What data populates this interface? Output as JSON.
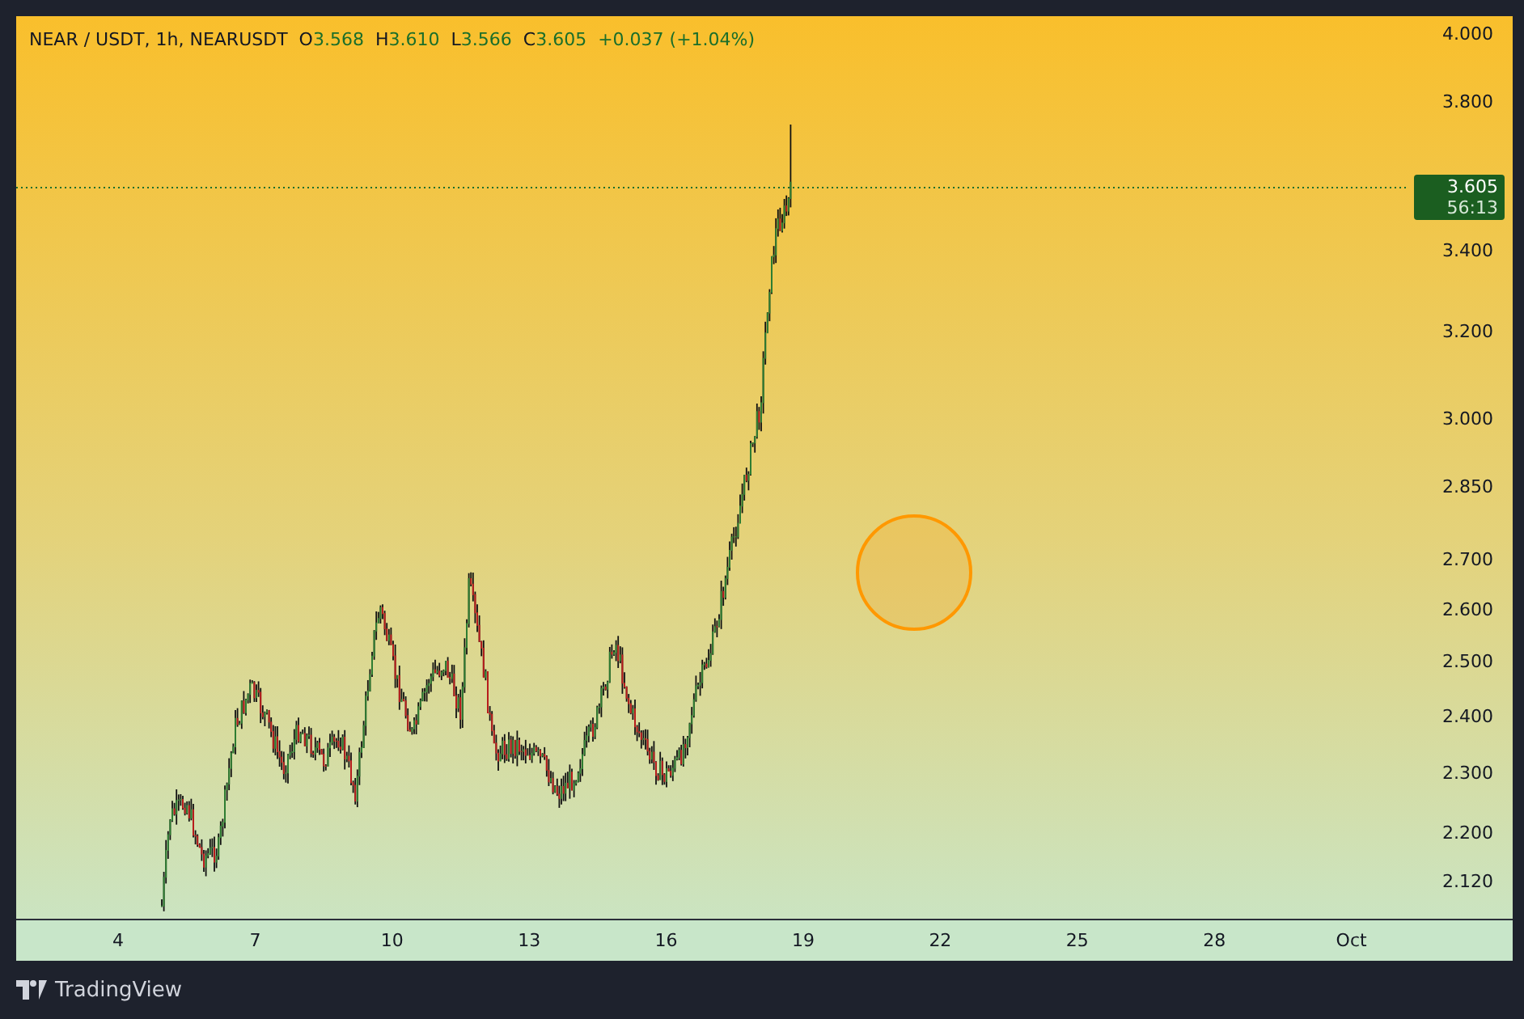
{
  "header": {
    "symbol": "NEAR / USDT, 1h, NEARUSDT",
    "ohlc": [
      {
        "label": "O",
        "value": "3.568"
      },
      {
        "label": "H",
        "value": "3.610"
      },
      {
        "label": "L",
        "value": "3.566"
      },
      {
        "label": "C",
        "value": "3.605"
      }
    ],
    "change": "+0.037 (+1.04%)"
  },
  "price_axis": {
    "ticks": [
      "4.000",
      "3.800",
      "3.400",
      "3.200",
      "3.000",
      "2.850",
      "2.700",
      "2.600",
      "2.500",
      "2.400",
      "2.300",
      "2.200",
      "2.120"
    ],
    "last_price": {
      "value": "3.605",
      "countdown": "56:13"
    }
  },
  "time_axis": {
    "ticks": [
      "4",
      "7",
      "10",
      "13",
      "16",
      "19",
      "22",
      "25",
      "28",
      "Oct"
    ]
  },
  "annotation": {
    "kind": "circle"
  },
  "footer": {
    "brand": "TradingView"
  }
}
